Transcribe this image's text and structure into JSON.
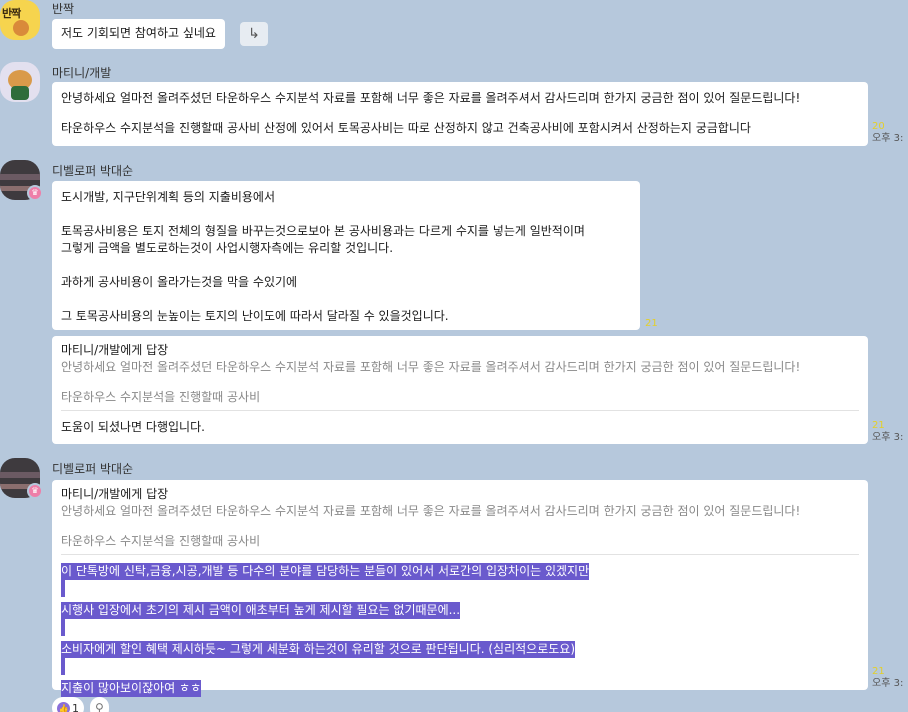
{
  "messages": {
    "m1": {
      "sender": "반짝",
      "avatar_text": "반짝",
      "text": "저도 기회되면 참여하고 싶네요",
      "share_icon": "share-arrow-icon"
    },
    "m2": {
      "sender": "마티니/개발",
      "line1": "안녕하세요 얼마전 올려주셨던 타운하우스 수지분석 자료를 포함해 너무 좋은 자료를 올려주셔서 감사드리며 한가지 궁금한 점이 있어 질문드립니다!",
      "line2": "타운하우스 수지분석을 진행할때 공사비 산정에 있어서 토목공사비는 따로 산정하지 않고 건축공사비에 포함시켜서 산정하는지 궁금합니다",
      "count": "20",
      "time": "오후 3:"
    },
    "m3": {
      "sender": "디벨로퍼 박대순",
      "lines": [
        "도시개발, 지구단위계획 등의 지출비용에서",
        "",
        "토목공사비용은 토지 전체의 형질을 바꾸는것으로보아 본 공사비용과는 다르게 수지를 넣는게 일반적이며",
        "그렇게 금액을 별도로하는것이 사업시행자측에는 유리할 것입니다.",
        "",
        "과하게 공사비용이 올라가는것을 막을 수있기에",
        "",
        "그 토목공사비용의 눈높이는 토지의 난이도에 따라서 달라질 수 있을것입니다."
      ],
      "count": "21"
    },
    "m4": {
      "reply_to": "마티니/개발에게 답장",
      "quote1": "안녕하세요 얼마전 올려주셨던 타운하우스 수지분석 자료를 포함해 너무 좋은 자료를 올려주셔서 감사드리며 한가지 궁금한 점이 있어 질문드립니다!",
      "quote2": "타운하우스 수지분석을 진행할때 공사비",
      "text": "도움이 되셨나면 다행입니다.",
      "count": "21",
      "time": "오후 3:"
    },
    "m5": {
      "sender": "디벨로퍼 박대순",
      "reply_to": "마티니/개발에게 답장",
      "quote1": "안녕하세요 얼마전 올려주셨던 타운하우스 수지분석 자료를 포함해 너무 좋은 자료를 올려주셔서 감사드리며 한가지 궁금한 점이 있어 질문드립니다!",
      "quote2": "타운하우스 수지분석을 진행할때 공사비",
      "highlighted_lines": [
        "이 단톡방에 신탁,금융,시공,개발 등 다수의 분야를 담당하는 분들이 있어서 서로간의 입장차이는 있겠지만",
        "시행사 입장에서 초기의 제시 금액이 애초부터 높게 제시할 필요는 없기때문에...",
        "소비자에게 할인 혜택 제시하듯~ 그렇게 세분화 하는것이 유리할 것으로 판단됩니다. (심리적으로도요)",
        "지출이 많아보이잖아여 ㅎㅎ"
      ],
      "count": "21",
      "time": "오후 3:"
    }
  },
  "reactions": {
    "like_count": "1",
    "like_icon": "thumbs-up-icon",
    "person_icon": "person-icon"
  },
  "colors": {
    "background": "#b6c8dc",
    "highlight": "#6a5acd",
    "unread": "#e3cf2a",
    "crown_badge": "#ee7fa9"
  }
}
